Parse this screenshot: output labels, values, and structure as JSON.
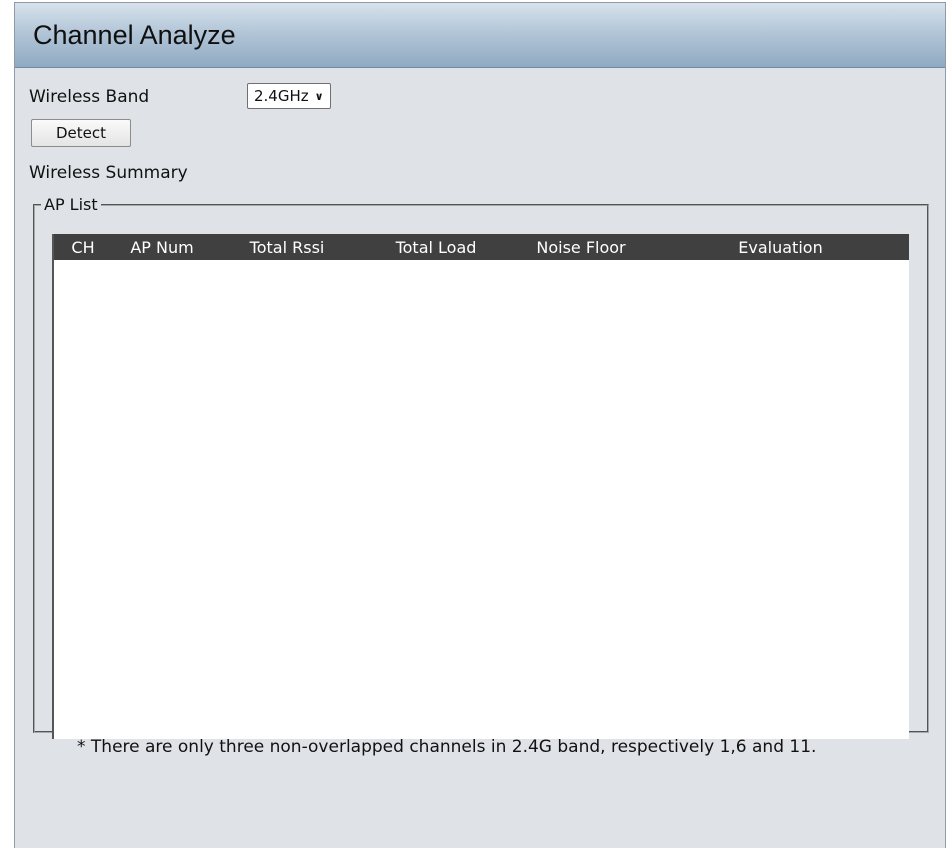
{
  "header": {
    "title": "Channel Analyze"
  },
  "form": {
    "wireless_band_label": "Wireless Band",
    "wireless_band_value": "2.4GHz",
    "detect_label": "Detect",
    "summary_label": "Wireless Summary"
  },
  "ap_list": {
    "legend": "AP List",
    "columns": [
      "CH",
      "AP Num",
      "Total Rssi",
      "Total Load",
      "Noise Floor",
      "Evaluation"
    ],
    "rows": []
  },
  "footnote": "* There are only three non-overlapped channels in 2.4G band, respectively 1,6 and 11.",
  "icons": {
    "dropdown": "chevron-down-icon"
  },
  "colors": {
    "header_bg": "#404040",
    "panel_bg": "#dfe3e8",
    "title_gradient_end": "#8faac2"
  }
}
